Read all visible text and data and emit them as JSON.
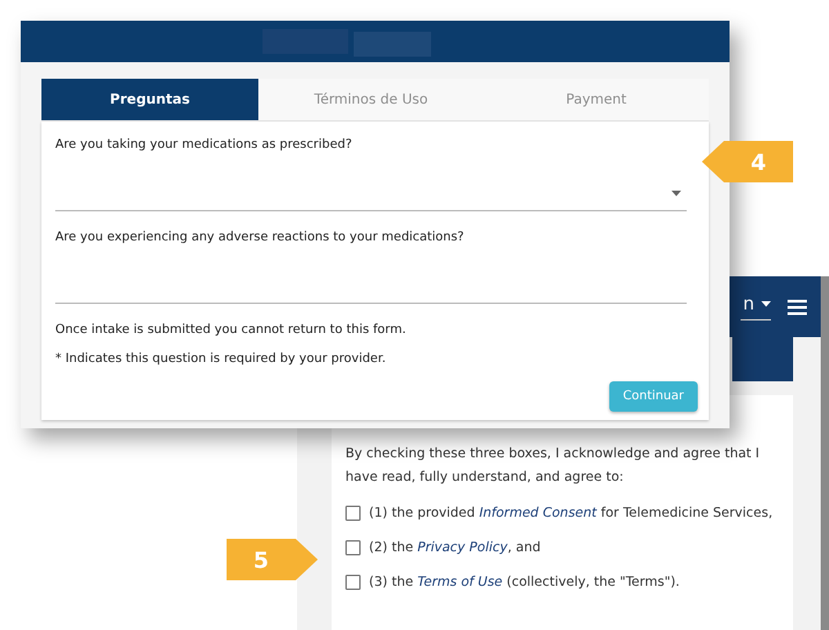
{
  "back_window": {
    "header": {
      "select_value": "n"
    },
    "intro": "By checking these three boxes, I acknowledge and agree that I have read, fully understand, and agree to:",
    "agreements": [
      {
        "before": "(1) the provided ",
        "link": "Informed Consent",
        "after": " for Telemedicine Services,",
        "checked": false
      },
      {
        "before": "(2) the ",
        "link": "Privacy Policy",
        "after": ", and",
        "checked": false
      },
      {
        "before": "(3) the ",
        "link": "Terms of Use",
        "after": " (collectively, the \"Terms\").",
        "checked": false
      }
    ]
  },
  "front_window": {
    "tabs": [
      {
        "label": "Preguntas",
        "selected": true
      },
      {
        "label": "Términos de Uso",
        "selected": false
      },
      {
        "label": "Payment",
        "selected": false
      }
    ],
    "questions": [
      {
        "label": "Are you taking your medications as prescribed?",
        "kind": "select"
      },
      {
        "label": "Are you experiencing any adverse reactions to your medications?",
        "kind": "text"
      }
    ],
    "notes": [
      "Once intake is submitted you cannot return to this form.",
      "* Indicates this question is required by your provider."
    ],
    "button": "Continuar"
  },
  "callouts": [
    {
      "number": "4",
      "kind": "points-left"
    },
    {
      "number": "5",
      "kind": "points-right"
    }
  ]
}
